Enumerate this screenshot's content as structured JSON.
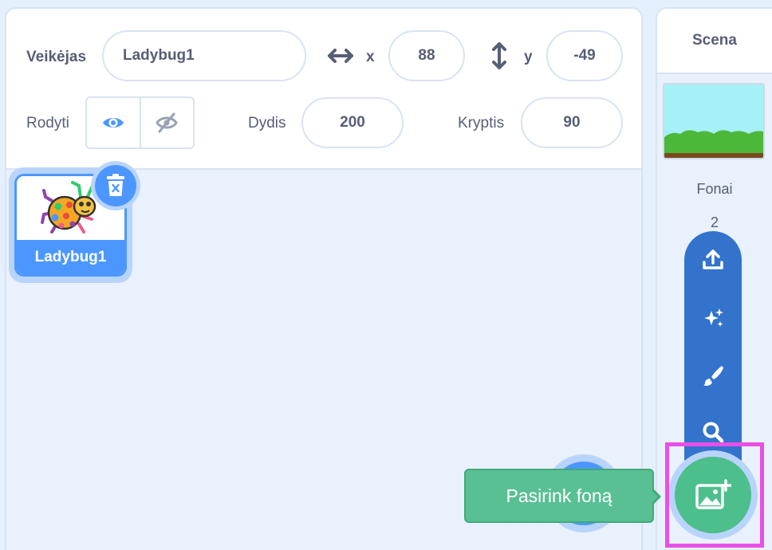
{
  "sprite_info": {
    "sprite_label": "Veikėjas",
    "sprite_name": "Ladybug1",
    "x_label": "x",
    "x_value": "88",
    "y_label": "y",
    "y_value": "-49",
    "show_label": "Rodyti",
    "size_label": "Dydis",
    "size_value": "200",
    "direction_label": "Kryptis",
    "direction_value": "90"
  },
  "sprites": [
    {
      "name": "Ladybug1",
      "selected": true,
      "icon": "ladybug-costume"
    }
  ],
  "stage": {
    "title": "Scena",
    "backdrops_label": "Fonai",
    "backdrops_count": "2"
  },
  "backdrop_menu": {
    "items": [
      "upload-icon",
      "surprise-icon",
      "paint-icon",
      "search-icon"
    ],
    "main_icon": "choose-backdrop-icon"
  },
  "tooltip": {
    "text": "Pasirink foną"
  },
  "colors": {
    "primary": "#4c97ff",
    "primary_dark": "#3373cc",
    "extension_green": "#4cbf8c",
    "highlight": "#e94fe7",
    "text": "#575e75"
  }
}
